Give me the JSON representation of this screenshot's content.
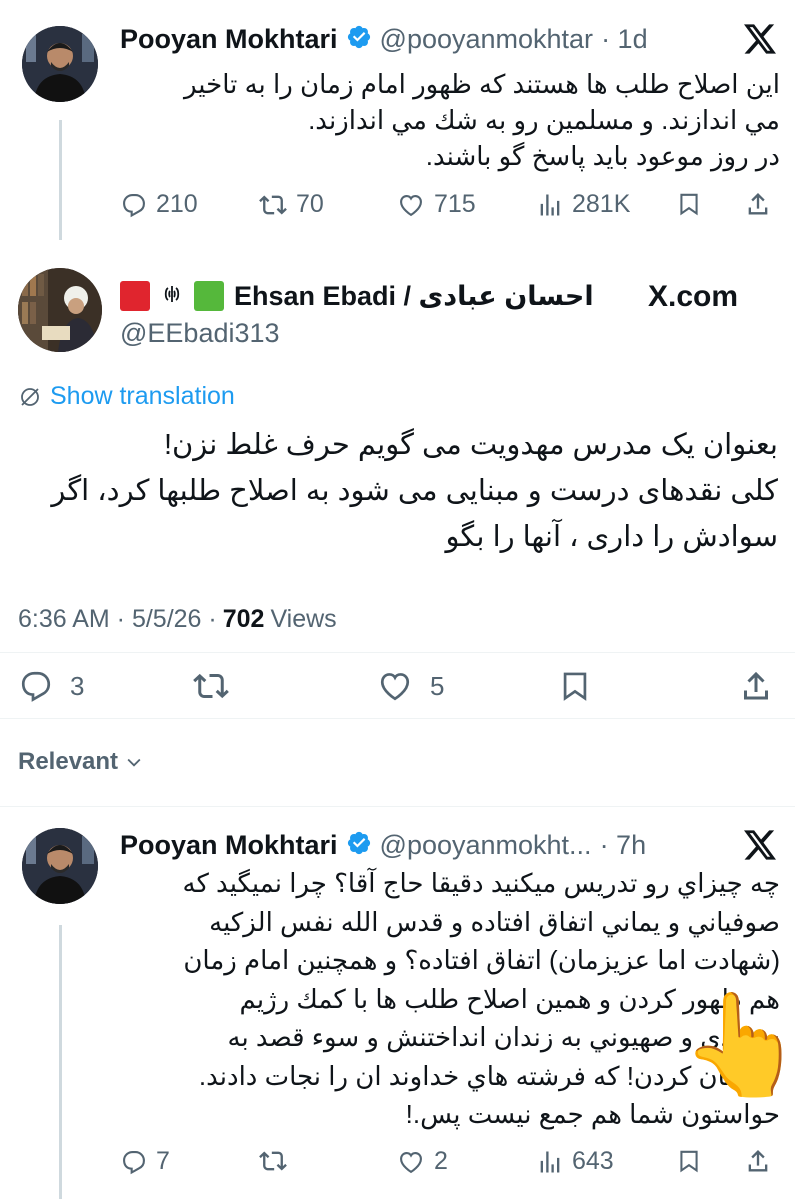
{
  "tweet1": {
    "name": "Pooyan Mokhtari",
    "handle": "@pooyanmokhtar",
    "time": "· 1d",
    "lines": [
      "اين اصلاح طلب ها هستند كه ظهور امام زمان را به تاخير",
      "مي اندازند. و مسلمين رو به شك مي اندازند.",
      "در روز موعود بايد پاسخ گو باشند."
    ],
    "replies": "210",
    "reposts": "70",
    "likes": "715",
    "views": "281K"
  },
  "tweet2": {
    "name": "Ehsan Ebadi / احسان عبادی",
    "handle": "@EEbadi313",
    "watermark": "X.com",
    "translate_label": "Show translation",
    "lines": [
      "بعنوان یک مدرس مهدویت می گویم حرف غلط نزن!",
      "کلی نقدهای درست و مبنایی می شود به اصلاح طلبها کرد، اگر",
      "سوادش را داری ، آنها را بگو"
    ],
    "time": "6:36 AM · 5/5/26 ·",
    "views_count": "702",
    "views_label": "Views",
    "replies": "3",
    "likes": "5"
  },
  "sort": {
    "label": "Relevant"
  },
  "tweet3": {
    "name": "Pooyan Mokhtari",
    "handle": "@pooyanmokht...",
    "time": "· 7h",
    "lines": [
      "چه چيزاي رو تدريس ميكنيد دقيقا حاج آقا؟ چرا نميگيد كه",
      "صوفياني و يماني اتفاق افتاده و  قدس الله نفس الزكيه",
      "(شهادت اما عزيزمان) اتفاق افتاده؟ و همچنين امام زمان",
      "هم ظهور كردن و همين اصلاح طلب ها با كمك رژيم",
      "سعودي و صهيوني به زندان انداختنش و سوء قصد به",
      "جانشان كردن! كه فرشته هاي خداوند ان را نجات دادند.",
      "حواستون شما هم جمع نيست پس.!"
    ],
    "replies": "7",
    "likes": "2",
    "views": "643"
  },
  "emoji": "👆"
}
